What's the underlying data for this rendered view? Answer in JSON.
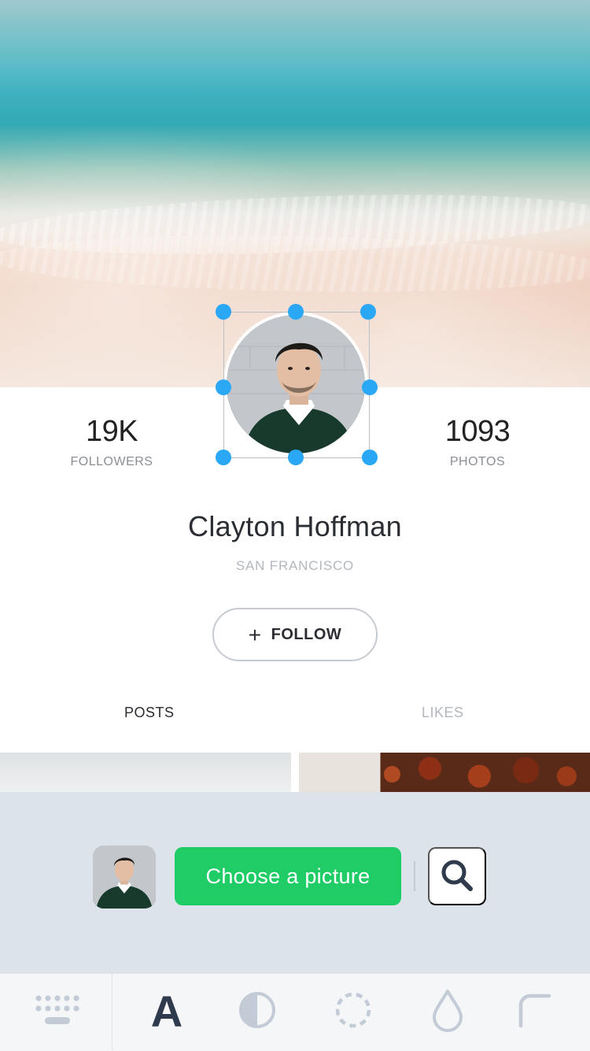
{
  "profile": {
    "followers_count": "19K",
    "followers_label": "FOLLOWERS",
    "photos_count": "1093",
    "photos_label": "PHOTOS",
    "name": "Clayton Hoffman",
    "location": "SAN FRANCISCO",
    "follow_icon": "+",
    "follow_label": "FOLLOW"
  },
  "tabs": [
    {
      "label": "POSTS",
      "active": true
    },
    {
      "label": "LIKES",
      "active": false
    }
  ],
  "picker": {
    "choose_label": "Choose a picture",
    "search_icon": "search-icon"
  },
  "toolbar": {
    "tools": [
      "keyboard-icon",
      "text-icon",
      "contrast-icon",
      "dashed-circle-icon",
      "drop-icon",
      "corner-radius-icon"
    ],
    "text_tool_glyph": "A"
  },
  "colors": {
    "accent_green": "#1fcc66",
    "selection_handle": "#2aa7f5",
    "panel_bg": "#dde3ea"
  }
}
